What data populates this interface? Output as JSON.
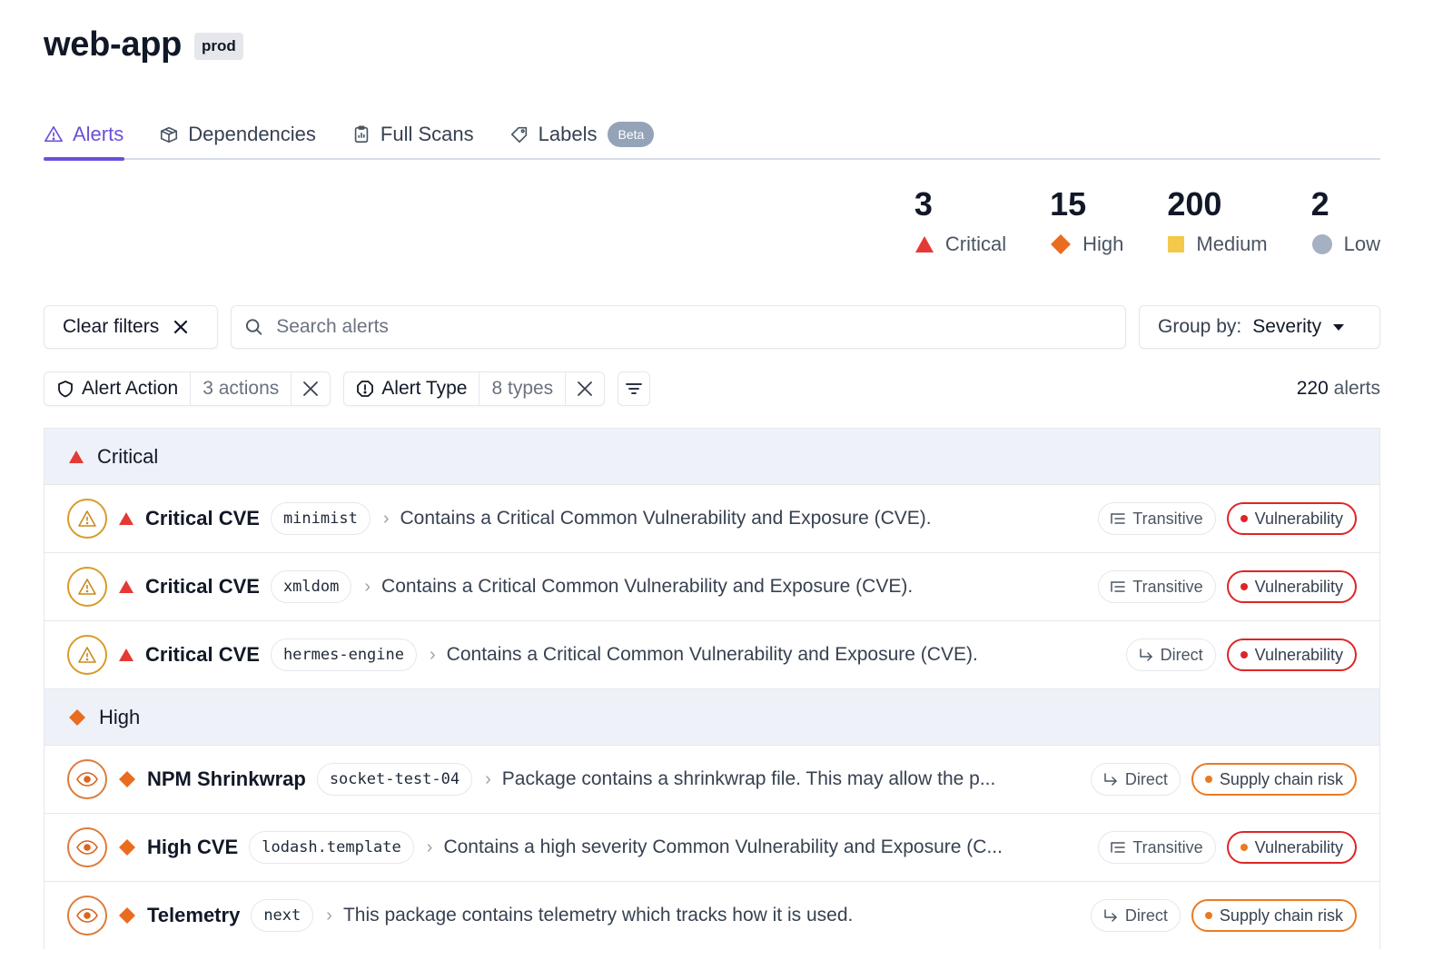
{
  "header": {
    "app_name": "web-app",
    "env_badge": "prod"
  },
  "tabs": [
    {
      "label": "Alerts",
      "icon": "alert-triangle-icon",
      "active": true
    },
    {
      "label": "Dependencies",
      "icon": "package-icon",
      "active": false
    },
    {
      "label": "Full Scans",
      "icon": "clipboard-icon",
      "active": false
    },
    {
      "label": "Labels",
      "icon": "tag-icon",
      "active": false,
      "badge": "Beta"
    }
  ],
  "stats": [
    {
      "count": "3",
      "label": "Critical",
      "icon": "triangle",
      "color": "#e53935"
    },
    {
      "count": "15",
      "label": "High",
      "icon": "diamond",
      "color": "#ea6c1e"
    },
    {
      "count": "200",
      "label": "Medium",
      "icon": "square",
      "color": "#f3c94a"
    },
    {
      "count": "2",
      "label": "Low",
      "icon": "circle",
      "color": "#a5b0c2"
    }
  ],
  "filters": {
    "clear_label": "Clear filters",
    "search_placeholder": "Search alerts",
    "group_by_label": "Group by:",
    "group_by_value": "Severity",
    "chips": [
      {
        "name": "Alert Action",
        "count": "3 actions"
      },
      {
        "name": "Alert Type",
        "count": "8 types"
      }
    ],
    "total_count": "220",
    "total_suffix": "alerts"
  },
  "groups": [
    {
      "label": "Critical",
      "rows": [
        {
          "title": "Critical CVE",
          "package": "minimist",
          "description": "Contains a Critical Common Vulnerability and Exposure (CVE).",
          "dependency": "Transitive",
          "category": "Vulnerability"
        },
        {
          "title": "Critical CVE",
          "package": "xmldom",
          "description": "Contains a Critical Common Vulnerability and Exposure (CVE).",
          "dependency": "Transitive",
          "category": "Vulnerability"
        },
        {
          "title": "Critical CVE",
          "package": "hermes-engine",
          "description": "Contains a Critical Common Vulnerability and Exposure (CVE).",
          "dependency": "Direct",
          "category": "Vulnerability"
        }
      ]
    },
    {
      "label": "High",
      "rows": [
        {
          "title": "NPM Shrinkwrap",
          "package": "socket-test-04",
          "description": "Package contains a shrinkwrap file. This may allow the p...",
          "dependency": "Direct",
          "category": "Supply chain risk"
        },
        {
          "title": "High CVE",
          "package": "lodash.template",
          "description": "Contains a high severity Common Vulnerability and Exposure (C...",
          "dependency": "Transitive",
          "category": "Vulnerability"
        },
        {
          "title": "Telemetry",
          "package": "next",
          "description": "This package contains telemetry which tracks how it is used.",
          "dependency": "Direct",
          "category": "Supply chain risk"
        }
      ]
    }
  ]
}
